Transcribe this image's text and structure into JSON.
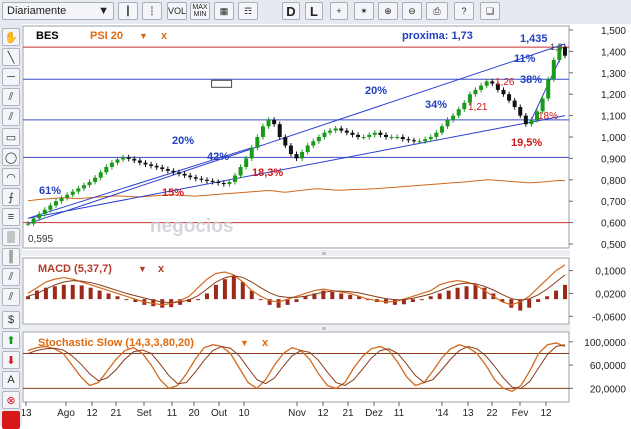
{
  "toolbar": {
    "period_label": "Diariamente",
    "buttons": [
      {
        "name": "candle-chart-icon",
        "label": "",
        "glyph": "┃"
      },
      {
        "name": "bar-chart-icon",
        "label": "",
        "glyph": "┆"
      },
      {
        "name": "vol-button",
        "label": "VOL",
        "glyph": ""
      },
      {
        "name": "maxmin-button",
        "label": "MAX MIN",
        "glyph": ""
      },
      {
        "name": "grid-icon",
        "label": "",
        "glyph": "▦"
      },
      {
        "name": "chart-type-icon",
        "label": "",
        "glyph": "☶"
      },
      {
        "name": "scale-d-button",
        "label": "D",
        "glyph": ""
      },
      {
        "name": "scale-l-button",
        "label": "L",
        "glyph": ""
      },
      {
        "name": "crosshair-icon",
        "label": "",
        "glyph": "+"
      },
      {
        "name": "draw-tool-icon",
        "label": "",
        "glyph": "✴"
      },
      {
        "name": "zoom-in-icon",
        "label": "",
        "glyph": "⊕"
      },
      {
        "name": "zoom-out-icon",
        "label": "",
        "glyph": "⊖"
      },
      {
        "name": "print-icon",
        "label": "",
        "glyph": "⎙"
      },
      {
        "name": "help-icon",
        "label": "?",
        "glyph": ""
      },
      {
        "name": "book-icon",
        "label": "",
        "glyph": "❑"
      }
    ]
  },
  "sidebar": {
    "tools": [
      {
        "name": "hand-tool-icon",
        "glyph": "✋"
      },
      {
        "name": "trend-line-tool-icon",
        "glyph": "╲"
      },
      {
        "name": "horizontal-line-tool-icon",
        "glyph": "─"
      },
      {
        "name": "channel-tool-icon",
        "glyph": "⫽"
      },
      {
        "name": "parallel-lines-tool-icon",
        "glyph": "⫽"
      },
      {
        "name": "rectangle-tool-icon",
        "glyph": "▭"
      },
      {
        "name": "ellipse-tool-icon",
        "glyph": "◯"
      },
      {
        "name": "arc-tool-icon",
        "glyph": "◠"
      },
      {
        "name": "fibonacci-fan-icon",
        "glyph": "⨍"
      },
      {
        "name": "fibonacci-levels-icon",
        "glyph": "≡"
      },
      {
        "name": "gann-tool-icon",
        "glyph": "▒"
      },
      {
        "name": "cycle-lines-icon",
        "glyph": "║"
      },
      {
        "name": "pitchfork-tool-icon",
        "glyph": "⫽"
      },
      {
        "name": "speed-lines-icon",
        "glyph": "⫽"
      },
      {
        "name": "dollar-tool-icon",
        "glyph": "$"
      },
      {
        "name": "buy-arrow-icon",
        "glyph": "⬆"
      },
      {
        "name": "sell-arrow-icon",
        "glyph": "⬇"
      },
      {
        "name": "text-tool-icon",
        "glyph": "A"
      },
      {
        "name": "delete-icon",
        "glyph": "⊗"
      },
      {
        "name": "color-swatch",
        "glyph": ""
      }
    ],
    "accent_red": "#d81818",
    "green": "#1a9a1a"
  },
  "chart_data": {
    "type": "candlestick",
    "symbol": "BES",
    "overlay": "PSI 20",
    "overlay_close": "x",
    "proxima_label": "proxima: 1,73",
    "x_tick_labels": [
      "13",
      "Ago",
      "12",
      "21",
      "Set",
      "11",
      "20",
      "Out",
      "10",
      "Nov",
      "12",
      "21",
      "Dez",
      "11",
      "'14",
      "13",
      "22",
      "Fev",
      "12"
    ],
    "price_axis": {
      "min": 0.5,
      "max": 1.5,
      "ticks": [
        "1,500",
        "1,400",
        "1,300",
        "1,200",
        "1,100",
        "1,000",
        "0,900",
        "0,800",
        "0,700",
        "0,600",
        "0,500"
      ]
    },
    "prices": [
      0.595,
      0.62,
      0.64,
      0.66,
      0.68,
      0.7,
      0.715,
      0.73,
      0.745,
      0.76,
      0.775,
      0.79,
      0.81,
      0.835,
      0.86,
      0.88,
      0.895,
      0.905,
      0.898,
      0.89,
      0.88,
      0.872,
      0.865,
      0.858,
      0.85,
      0.842,
      0.835,
      0.828,
      0.82,
      0.812,
      0.805,
      0.8,
      0.795,
      0.79,
      0.785,
      0.78,
      0.79,
      0.82,
      0.86,
      0.9,
      0.95,
      1.0,
      1.05,
      1.08,
      1.06,
      1.0,
      0.96,
      0.92,
      0.9,
      0.93,
      0.96,
      0.98,
      1.0,
      1.02,
      1.03,
      1.04,
      1.03,
      1.02,
      1.01,
      1.0,
      1.0,
      1.01,
      1.02,
      1.01,
      1.0,
      1.0,
      1.0,
      0.99,
      0.985,
      0.98,
      0.98,
      0.99,
      1.0,
      1.02,
      1.05,
      1.08,
      1.1,
      1.13,
      1.16,
      1.2,
      1.22,
      1.24,
      1.26,
      1.25,
      1.22,
      1.2,
      1.17,
      1.14,
      1.1,
      1.06,
      1.08,
      1.12,
      1.18,
      1.27,
      1.36,
      1.42,
      1.38
    ],
    "psi20": [
      0.702,
      0.705,
      0.708,
      0.71,
      0.712,
      0.714,
      0.716,
      0.715,
      0.713,
      0.712,
      0.714,
      0.716,
      0.718,
      0.72,
      0.722,
      0.724,
      0.725,
      0.724,
      0.722,
      0.721,
      0.72,
      0.722,
      0.724,
      0.726,
      0.728,
      0.729,
      0.73,
      0.728,
      0.726,
      0.725,
      0.724,
      0.726,
      0.728,
      0.73,
      0.732,
      0.734,
      0.736,
      0.738,
      0.74,
      0.742,
      0.744,
      0.746,
      0.748,
      0.75,
      0.748,
      0.744,
      0.742,
      0.745,
      0.748,
      0.751,
      0.754,
      0.757,
      0.758,
      0.756,
      0.754,
      0.752,
      0.752,
      0.753,
      0.754,
      0.755,
      0.756,
      0.757,
      0.758,
      0.76,
      0.762,
      0.764,
      0.766,
      0.768,
      0.77,
      0.772,
      0.774,
      0.776,
      0.778,
      0.78,
      0.782,
      0.784,
      0.786,
      0.788,
      0.79,
      0.792,
      0.795,
      0.797,
      0.8,
      0.799,
      0.797,
      0.795,
      0.793,
      0.791,
      0.789,
      0.787,
      0.786,
      0.788,
      0.79,
      0.792,
      0.795,
      0.797,
      0.796
    ],
    "h_levels": [
      1.42,
      1.27,
      1.08,
      0.905,
      0.6
    ],
    "level_colors": [
      "#c83030",
      "#3c4cc8",
      "#3c4cc8",
      "#3c4cc8",
      "#c83030"
    ],
    "annotations_blue": [
      "61%",
      "20%",
      "42%",
      "20%",
      "34%",
      "38%",
      "11%",
      "1,435",
      "1,3"
    ],
    "annotations_red": [
      "15%",
      "18,3%",
      "1,26",
      "1,21",
      "18%",
      "19,5%"
    ],
    "low_label": "0,595",
    "watermark": "negocios",
    "macd": {
      "title": "MACD (5,37,7)",
      "ticks": [
        "0,1000",
        "0,0200",
        "-0,0600"
      ],
      "range": [
        -0.08,
        0.13
      ],
      "hist": [
        0.01,
        0.03,
        0.04,
        0.045,
        0.05,
        0.05,
        0.048,
        0.04,
        0.03,
        0.02,
        0.01,
        0.0,
        -0.01,
        -0.02,
        -0.025,
        -0.03,
        -0.028,
        -0.02,
        -0.01,
        0.0,
        0.02,
        0.05,
        0.07,
        0.08,
        0.06,
        0.03,
        0.0,
        -0.02,
        -0.03,
        -0.02,
        -0.01,
        0.01,
        0.02,
        0.03,
        0.025,
        0.02,
        0.015,
        0.01,
        0.0,
        -0.01,
        -0.015,
        -0.02,
        -0.018,
        -0.01,
        0.0,
        0.01,
        0.02,
        0.03,
        0.04,
        0.045,
        0.05,
        0.04,
        0.02,
        -0.01,
        -0.03,
        -0.04,
        -0.03,
        -0.01,
        0.01,
        0.03,
        0.05
      ],
      "line": [
        0.02,
        0.04,
        0.06,
        0.07,
        0.075,
        0.07,
        0.06,
        0.05,
        0.04,
        0.03,
        0.02,
        0.01,
        0.0,
        -0.01,
        -0.015,
        -0.02,
        -0.015,
        -0.005,
        0.01,
        0.04,
        0.07,
        0.09,
        0.095,
        0.085,
        0.06,
        0.03,
        0.01,
        -0.005,
        -0.01,
        0.0,
        0.01,
        0.02,
        0.03,
        0.035,
        0.03,
        0.025,
        0.02,
        0.01,
        0.0,
        -0.005,
        -0.01,
        -0.008,
        0.0,
        0.01,
        0.02,
        0.03,
        0.05,
        0.06,
        0.065,
        0.06,
        0.05,
        0.03,
        0.01,
        -0.01,
        -0.02,
        -0.01,
        0.01,
        0.04,
        0.07,
        0.1,
        0.12
      ],
      "signal": [
        0.01,
        0.02,
        0.035,
        0.05,
        0.06,
        0.065,
        0.063,
        0.058,
        0.05,
        0.04,
        0.03,
        0.02,
        0.012,
        0.004,
        -0.004,
        -0.01,
        -0.012,
        -0.01,
        -0.003,
        0.012,
        0.035,
        0.06,
        0.075,
        0.082,
        0.076,
        0.06,
        0.04,
        0.022,
        0.01,
        0.006,
        0.006,
        0.01,
        0.017,
        0.024,
        0.028,
        0.028,
        0.026,
        0.022,
        0.015,
        0.008,
        0.002,
        -0.002,
        -0.002,
        0.003,
        0.01,
        0.018,
        0.03,
        0.042,
        0.052,
        0.056,
        0.054,
        0.045,
        0.032,
        0.016,
        0.002,
        -0.004,
        0.001,
        0.015,
        0.035,
        0.06,
        0.085
      ]
    },
    "stochastic": {
      "title": "Stochastic Slow (14,3,3,80,20)",
      "ticks": [
        "100,0000",
        "60,0000",
        "20,0000"
      ],
      "range": [
        0,
        110
      ],
      "k": [
        85,
        90,
        92,
        88,
        80,
        60,
        40,
        25,
        30,
        50,
        70,
        85,
        90,
        80,
        60,
        35,
        20,
        25,
        45,
        70,
        90,
        95,
        92,
        80,
        55,
        30,
        20,
        35,
        60,
        80,
        90,
        85,
        70,
        45,
        25,
        20,
        30,
        55,
        75,
        88,
        92,
        85,
        65,
        40,
        25,
        30,
        50,
        72,
        88,
        95,
        90,
        80,
        60,
        35,
        20,
        15,
        25,
        50,
        80,
        95,
        98,
        92
      ],
      "d": [
        80,
        85,
        88,
        89,
        86,
        76,
        62,
        45,
        33,
        38,
        52,
        70,
        83,
        86,
        80,
        62,
        42,
        28,
        30,
        48,
        68,
        85,
        92,
        89,
        76,
        55,
        35,
        28,
        38,
        58,
        76,
        85,
        82,
        68,
        48,
        30,
        25,
        35,
        53,
        72,
        85,
        88,
        80,
        62,
        42,
        30,
        35,
        52,
        70,
        85,
        92,
        88,
        76,
        58,
        38,
        22,
        20,
        32,
        55,
        78,
        92,
        95
      ]
    }
  }
}
